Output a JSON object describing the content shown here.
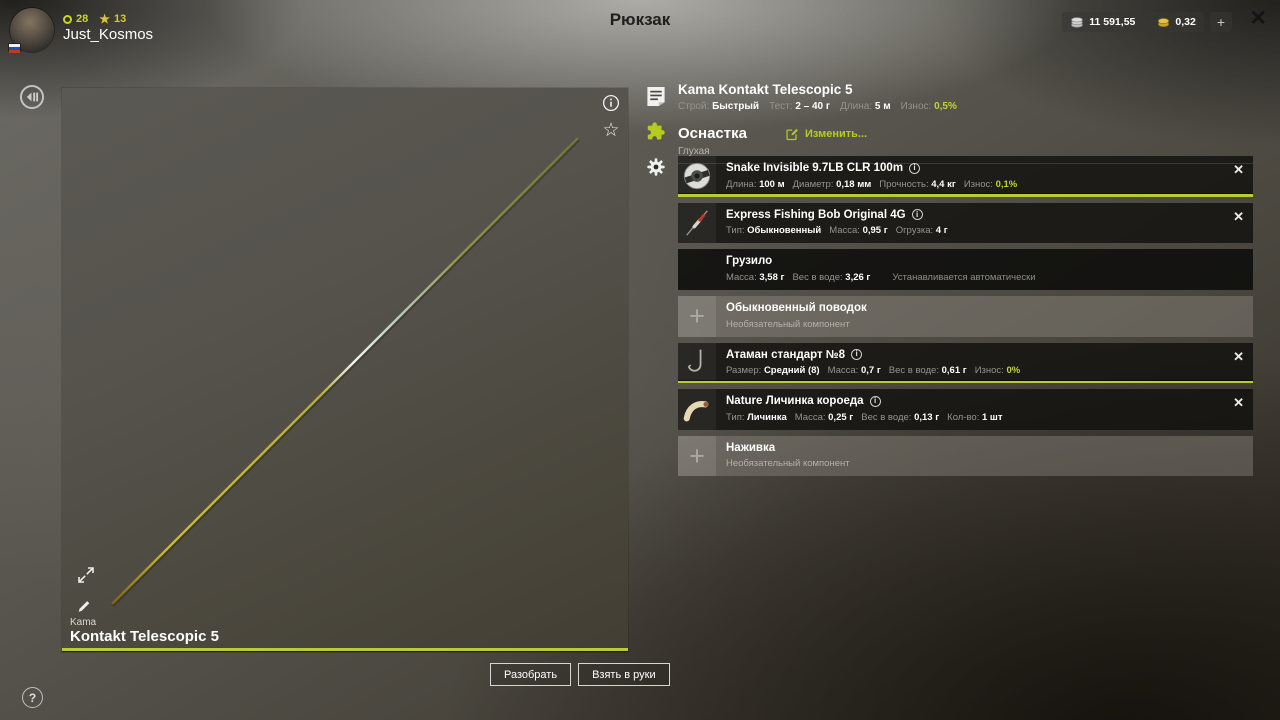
{
  "topbar": {
    "title": "Рюкзак",
    "player": {
      "name": "Just_Kosmos",
      "level": "28",
      "stars": "13"
    },
    "money": {
      "silver": "11 591,55",
      "gold": "0,32",
      "add_label": "+"
    },
    "close_label": "✕"
  },
  "icons": {
    "plus_glyph": "+",
    "close_glyph": "✕",
    "star_glyph": "★",
    "fav_star_glyph": "☆",
    "help_glyph": "?"
  },
  "colors": {
    "accent": "#b7cd33",
    "gold": "#d9c43a",
    "silver_text": "#ffffff"
  },
  "preview": {
    "brand": "Kama",
    "name": "Kontakt Telescopic 5",
    "buttons": {
      "disassemble": "Разобрать",
      "take": "Взять в руки"
    }
  },
  "panel": {
    "title": "Kama Kontakt Telescopic 5",
    "stats": [
      {
        "label": "Строй:",
        "value": "Быстрый"
      },
      {
        "label": "Тест:",
        "value": "2 – 40 г"
      },
      {
        "label": "Длина:",
        "value": "5 м"
      },
      {
        "label": "Износ:",
        "value": "0,5%",
        "accent": true
      }
    ],
    "section_title": "Оснастка",
    "edit_label": "Изменить...",
    "rig_type": "Глухая",
    "rows": [
      {
        "icon": "line-spool",
        "variant": "dark",
        "info": true,
        "closable": true,
        "bar": true,
        "title": "Snake Invisible 9.7LB CLR 100m",
        "stats": [
          {
            "label": "Длина:",
            "value": "100 м"
          },
          {
            "label": "Диаметр:",
            "value": "0,18 мм"
          },
          {
            "label": "Прочность:",
            "value": "4,4 кг"
          },
          {
            "label": "Износ:",
            "value": "0,1%",
            "accent": true
          }
        ]
      },
      {
        "icon": "float",
        "variant": "dark",
        "info": true,
        "closable": true,
        "title": "Express Fishing Bob Original 4G",
        "stats": [
          {
            "label": "Тип:",
            "value": "Обыкновенный"
          },
          {
            "label": "Масса:",
            "value": "0,95 г"
          },
          {
            "label": "Огрузка:",
            "value": "4 г"
          }
        ]
      },
      {
        "icon": "none",
        "variant": "darker",
        "title": "Грузило",
        "stats": [
          {
            "label": "Масса:",
            "value": "3,58 г"
          },
          {
            "label": "Вес в воде:",
            "value": "3,26 г"
          }
        ],
        "note": "Устанавливается автоматически"
      },
      {
        "icon": "plus",
        "variant": "light",
        "title": "Обыкновенный поводок",
        "subtitle": "Необязательный компонент"
      },
      {
        "icon": "hook",
        "variant": "dark",
        "info": true,
        "closable": true,
        "bar": true,
        "title": "Атаман стандарт №8",
        "stats": [
          {
            "label": "Размер:",
            "value": "Средний (8)"
          },
          {
            "label": "Масса:",
            "value": "0,7 г"
          },
          {
            "label": "Вес в воде:",
            "value": "0,61 г"
          },
          {
            "label": "Износ:",
            "value": "0%",
            "accent": true
          }
        ]
      },
      {
        "icon": "larva",
        "variant": "dark",
        "info": true,
        "closable": true,
        "title": "Nature Личинка короеда",
        "stats": [
          {
            "label": "Тип:",
            "value": "Личинка"
          },
          {
            "label": "Масса:",
            "value": "0,25 г"
          },
          {
            "label": "Вес в воде:",
            "value": "0,13 г"
          },
          {
            "label": "Кол-во:",
            "value": "1 шт"
          }
        ]
      },
      {
        "icon": "plus",
        "variant": "light",
        "title": "Наживка",
        "subtitle": "Необязательный компонент"
      }
    ]
  }
}
